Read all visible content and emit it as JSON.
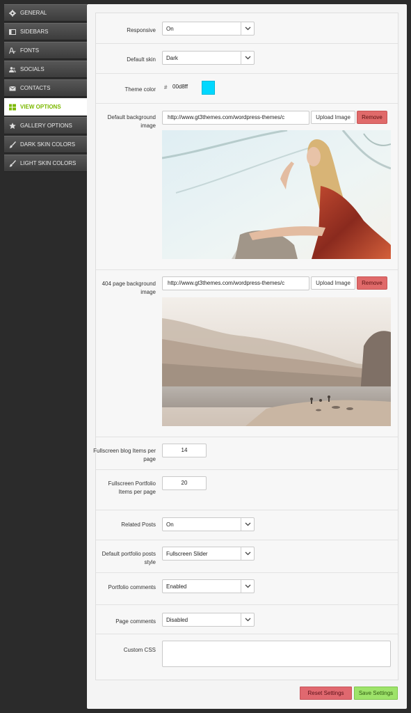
{
  "sidebar": {
    "items": [
      {
        "label": "GENERAL",
        "icon": "gear-icon"
      },
      {
        "label": "SIDEBARS",
        "icon": "columns-icon"
      },
      {
        "label": "FONTS",
        "icon": "font-icon"
      },
      {
        "label": "SOCIALS",
        "icon": "users-icon"
      },
      {
        "label": "CONTACTS",
        "icon": "envelope-icon"
      },
      {
        "label": "VIEW OPTIONS",
        "icon": "grid-icon",
        "active": true
      },
      {
        "label": "GALLERY OPTIONS",
        "icon": "star-icon"
      },
      {
        "label": "DARK SKIN COLORS",
        "icon": "brush-icon"
      },
      {
        "label": "LIGHT SKIN COLORS",
        "icon": "brush-icon"
      }
    ]
  },
  "fields": {
    "responsive": {
      "label": "Responsive",
      "value": "On"
    },
    "default_skin": {
      "label": "Default skin",
      "value": "Dark"
    },
    "theme_color": {
      "label": "Theme color",
      "prefix": "#",
      "value": "00d8ff",
      "swatch": "#00d8ff"
    },
    "default_bg": {
      "label": "Default background image",
      "url": "http://www.gt3themes.com/wordpress-themes/c",
      "upload_label": "Upload Image",
      "remove_label": "Remove"
    },
    "bg_404": {
      "label": "404 page background image",
      "url": "http://www.gt3themes.com/wordpress-themes/c",
      "upload_label": "Upload Image",
      "remove_label": "Remove"
    },
    "blog_items": {
      "label": "Fullscreen blog Items per page",
      "value": "14"
    },
    "portfolio_items": {
      "label": "Fullscreen Portfolio Items per page",
      "value": "20"
    },
    "related_posts": {
      "label": "Related Posts",
      "value": "On"
    },
    "portfolio_style": {
      "label": "Default portfolio posts style",
      "value": "Fullscreen Slider"
    },
    "portfolio_comments": {
      "label": "Portfolio comments",
      "value": "Enabled"
    },
    "page_comments": {
      "label": "Page comments",
      "value": "Disabled"
    },
    "custom_css": {
      "label": "Custom CSS",
      "value": ""
    }
  },
  "footer": {
    "reset_label": "Reset Settings",
    "save_label": "Save Settings"
  },
  "colors": {
    "accent": "#7cb900",
    "remove": "#e06a6a",
    "save": "#9ee36a"
  }
}
